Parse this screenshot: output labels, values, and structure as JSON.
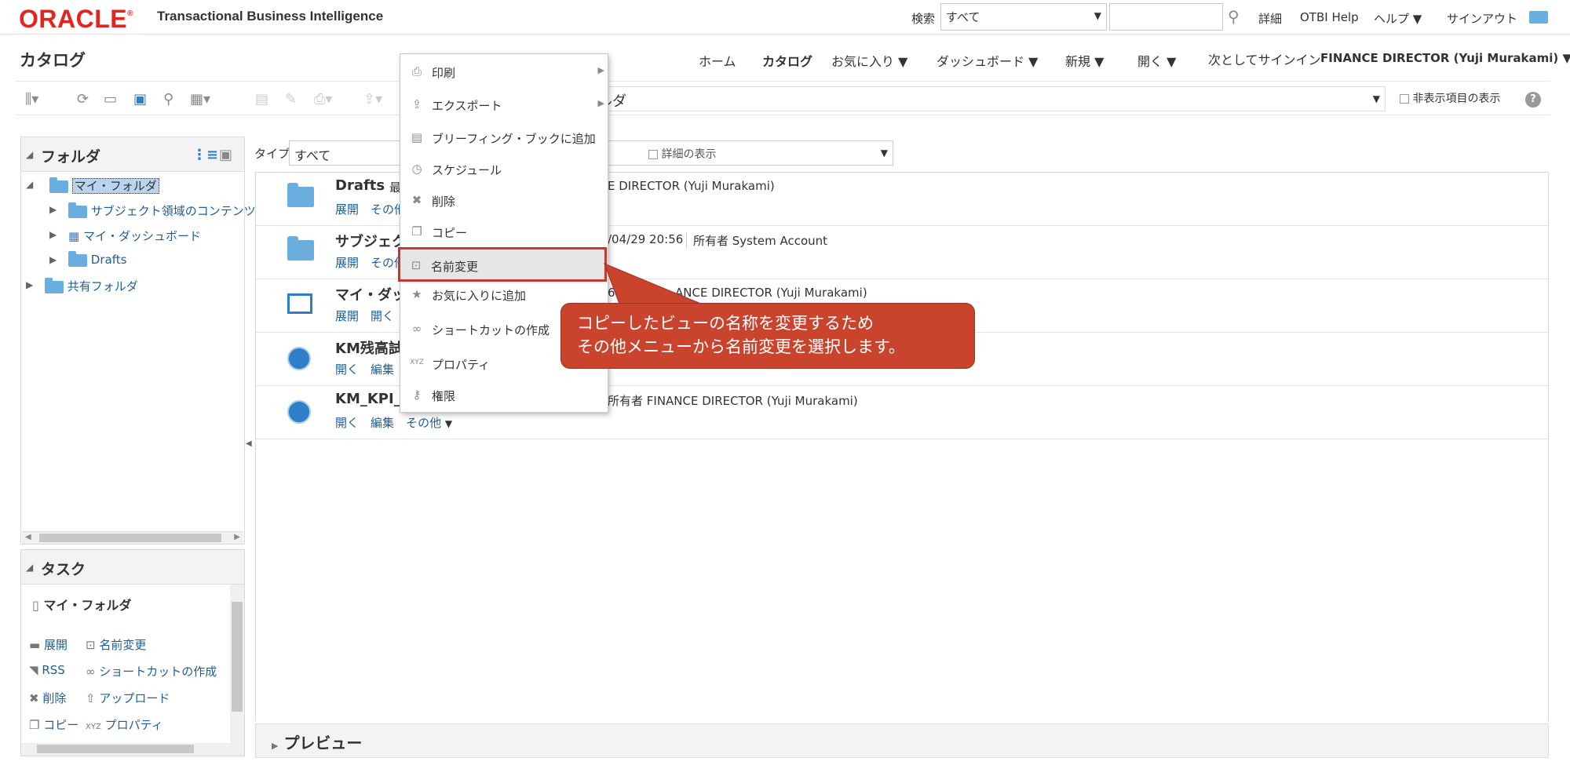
{
  "topbar": {
    "logo": "ORACLE",
    "app_title": "Transactional Business Intelligence",
    "search_label": "検索",
    "search_scope": "すべて",
    "search_placeholder": "",
    "details": "詳細",
    "otbi_help": "OTBI Help",
    "help": "ヘルプ",
    "signout": "サインアウト"
  },
  "header": {
    "page_title": "カタログ",
    "nav": {
      "home": "ホーム",
      "catalog": "カタログ",
      "favorites": "お気に入り",
      "dashboard": "ダッシュボード",
      "new": "新規",
      "open": "開く",
      "signin_as": "次としてサインイン",
      "user": "FINANCE DIRECTOR (Yuji Murakami)"
    }
  },
  "toolbar": {
    "path_fragment": "ルダ",
    "show_hidden": "非表示項目の表示"
  },
  "folders": {
    "title": "フォルダ",
    "my_folders": "マイ・フォルダ",
    "subject_area": "サブジェクト領域のコンテンツ",
    "my_dashboard": "マイ・ダッシュボード",
    "drafts": "Drafts",
    "shared_folders": "共有フォルダ"
  },
  "tasks": {
    "title": "タスク",
    "selected": "マイ・フォルダ",
    "expand": "展開",
    "rename": "名前変更",
    "rss": "RSS",
    "create_shortcut": "ショートカットの作成",
    "delete": "削除",
    "upload": "アップロード",
    "copy": "コピー",
    "properties": "プロパティ"
  },
  "filter": {
    "type_label": "タイプ",
    "type_value": "すべて",
    "show_details": "詳細の表示"
  },
  "items": [
    {
      "title": "Drafts",
      "meta_prefix": "最",
      "meta": "E DIRECTOR (Yuji Murakami)",
      "link1": "展開",
      "link2": "その他"
    },
    {
      "title": "サブジェク",
      "meta_prefix": "",
      "meta": "/04/29 20:56 ｜ 所有者 System Account",
      "link1": "展開",
      "link2": "その他"
    },
    {
      "title": "マイ・ダッ",
      "meta_prefix": "",
      "meta": "6 ｜ 所有者 FINANCE DIRECTOR (Yuji Murakami)",
      "link1": "展開",
      "link2": "開く"
    },
    {
      "title": "KM残高試",
      "meta_prefix": "",
      "meta": "",
      "link1": "開く",
      "link2": "編集"
    },
    {
      "title": "KM_KPI_I",
      "meta_prefix": "",
      "meta": "所有者 FINANCE DIRECTOR (Yuji Murakami)",
      "link1": "開く",
      "link2": "編集",
      "link3": "その他"
    }
  ],
  "row_meta_c": "ANCE DIRECTOR (Yuji Murakami)",
  "row_meta_c_prefix": "6",
  "row_meta_b_date": "/04/29 20:56",
  "row_meta_b_owner": "所有者 System Account",
  "preview": "プレビュー",
  "context_menu": [
    {
      "label": "印刷",
      "icon": "printer-icon",
      "submenu": true
    },
    {
      "label": "エクスポート",
      "icon": "export-icon",
      "submenu": true
    },
    {
      "label": "ブリーフィング・ブックに追加",
      "icon": "briefing-book-icon",
      "submenu": false
    },
    {
      "label": "スケジュール",
      "icon": "schedule-icon",
      "submenu": false
    },
    {
      "label": "削除",
      "icon": "delete-icon",
      "submenu": false
    },
    {
      "label": "コピー",
      "icon": "copy-icon",
      "submenu": false
    },
    {
      "label": "名前変更",
      "icon": "rename-icon",
      "submenu": false
    },
    {
      "label": "お気に入りに追加",
      "icon": "favorite-icon",
      "submenu": false
    },
    {
      "label": "ショートカットの作成",
      "icon": "shortcut-icon",
      "submenu": false
    },
    {
      "label": "プロパティ",
      "icon": "properties-icon",
      "submenu": false
    },
    {
      "label": "権限",
      "icon": "permissions-icon",
      "submenu": false
    }
  ],
  "callout": {
    "line1": "コピーしたビューの名称を変更するため",
    "line2": "その他メニューから名前変更を選択します。"
  },
  "colors": {
    "oracle_red": "#e3261d",
    "link_blue": "#1f5d99",
    "callout_red": "#c9432d"
  }
}
